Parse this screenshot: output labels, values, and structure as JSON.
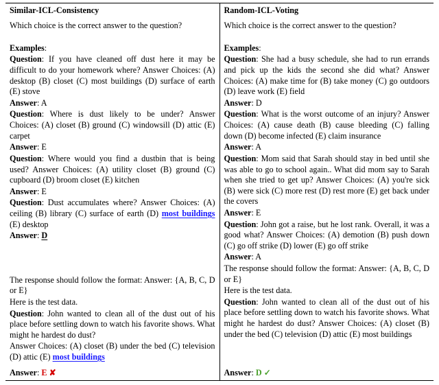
{
  "hdr": {
    "left": "Similar-ICL-Consistency",
    "right": "Random-ICL-Voting"
  },
  "L": {
    "intro": "Which choice is the correct answer to the question?",
    "exhdr": "Examples",
    "q1p": "Question",
    "q1": ": If you have cleaned off dust here it may be difficult to do your homework where? Answer Choices: (A) desktop (B) closet (C) most buildings (D) surface of earth (E) stove",
    "a1p": "Answer",
    "a1": ": A",
    "q2p": "Question",
    "q2": ": Where is dust likely to be under? Answer Choices: (A) closet (B) ground (C) windowsill (D) attic (E) carpet",
    "a2p": "Answer",
    "a2": ": E",
    "q3p": "Question",
    "q3": ": Where would you find a dustbin that is being used? Answer Choices: (A) utility closet (B) ground (C) cupboard (D) broom closet (E) kitchen",
    "a3p": "Answer",
    "a3": ": E",
    "q4p": "Question",
    "q4a": ": Dust accumulates where? Answer Choices: (A) ceiling (B) library (C) surface of earth (D) ",
    "q4hl": "most buildings",
    "q4b": " (E) desktop",
    "a4p": "Answer",
    "a4": ": ",
    "a4dl": "D",
    "fmt": "The response should follow the format: Answer: {A, B, C, D or E}",
    "test": "Here is the test data.",
    "tqp": "Question",
    "tq": ": John wanted to clean all of the dust out of his place before settling down to watch his favorite shows. What might he hardest do dust?",
    "tc_a": "Answer Choices: (A) closet (B) under the bed (C) television (D) attic (E) ",
    "tc_hl": "most buildings",
    "ansp": "Answer",
    "anssep": ": ",
    "ansv": "E",
    "mark": " ✘"
  },
  "R": {
    "intro": "Which choice is the correct answer to the question?",
    "exhdr": "Examples",
    "q1p": "Question",
    "q1": ": She had a busy schedule, she had to run errands and pick up the kids the second she did what? Answer Choices: (A) make time for (B) take money (C) go outdoors (D) leave work (E) field",
    "a1p": "Answer",
    "a1": ": D",
    "q2p": "Question",
    "q2": ": What is the worst outcome of an injury? Answer Choices: (A) cause death (B) cause bleeding (C) falling down (D) become infected (E) claim insurance",
    "a2p": "Answer",
    "a2": ": A",
    "q3p": "Question",
    "q3": ": Mom said that Sarah should stay in bed until she was able to go to school again.. What did mom say to Sarah when she tried to get up? Answer Choices: (A) you're sick (B) were sick (C) more rest (D) rest more (E) get back under the covers",
    "a3p": "Answer",
    "a3": ": E",
    "q4p": "Question",
    "q4": ": John got a raise, but he lost rank. Overall, it was a good what? Answer Choices: (A) demotion (B) push down (C) go off strike (D) lower (E) go off strike",
    "a4p": "Answer",
    "a4": ": A",
    "fmt": "The response should follow the format: Answer: {A, B, C, D or E}",
    "test": "Here is the test data.",
    "tqp": "Question",
    "tq": ": John wanted to clean all of the dust out of his place before settling down to watch his favorite shows. What might he hardest do dust? Answer Choices: (A) closet (B) under the bed (C) television (D) attic (E) most buildings",
    "ansp": "Answer",
    "anssep": ": ",
    "ansv": "D",
    "mark": " ✓"
  }
}
